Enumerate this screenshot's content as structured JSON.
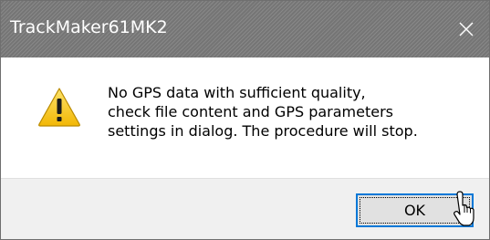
{
  "window": {
    "title": "TrackMaker61MK2"
  },
  "message": {
    "lines": [
      "No GPS data with sufficient quality,",
      "check file content and GPS parameters",
      "settings in dialog. The procedure will stop."
    ],
    "icon": "warning-icon"
  },
  "buttons": {
    "ok_label": "OK"
  },
  "icons": {
    "close": "close-icon",
    "warning": "warning-icon",
    "cursor": "mouse-cursor-icon"
  },
  "colors": {
    "titlebar": "#7a7a7a",
    "footer": "#f0f0f0",
    "focus_border": "#0078d7",
    "warning_fill": "#f7d02c"
  }
}
